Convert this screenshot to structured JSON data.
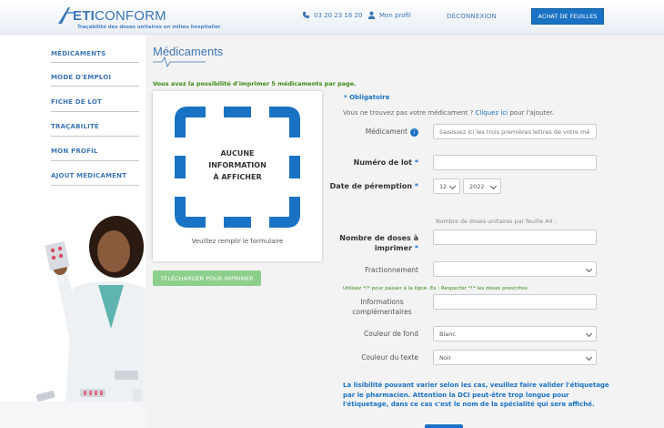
{
  "header": {
    "logo_part1": "ETI",
    "logo_part2": "CONFORM",
    "tagline": "Traçabilité des doses unitaires en milieu hospitalier",
    "phone": "03 20 23 16 20",
    "profile_label": "Mon profil",
    "logout_label": "DÉCONNEXION",
    "buy_label": "ACHAT DE FEUILLES"
  },
  "sidebar": {
    "items": [
      {
        "label": "MÉDICAMENTS"
      },
      {
        "label": "MODE D'EMPLOI"
      },
      {
        "label": "FICHE DE LOT"
      },
      {
        "label": "TRAÇABILITÉ"
      },
      {
        "label": "MON PROFIL"
      },
      {
        "label": "AJOUT MÉDICAMENT"
      }
    ]
  },
  "main": {
    "title": "Médicaments",
    "notice": "Vous avez la possibilité d'imprimer 5 médicaments par page.",
    "preview": {
      "line1": "AUCUNE",
      "line2": "INFORMATION",
      "line3": "À AFFICHER",
      "caption": "Veuillez remplir le formulaire"
    },
    "download_label": "TÉLÉCHARGER POUR IMPRIMER"
  },
  "form": {
    "required_note": "* Obligatoire",
    "not_found_prefix": "Vous ne trouvez pas votre médicament ?",
    "not_found_link": "Cliquez ici",
    "not_found_suffix": "pour l'ajouter.",
    "medicament_label": "Médicament",
    "medicament_placeholder": "Saisissez ici les trois premières lettres de votre mé",
    "lot_label": "Numéro de lot",
    "expiry_label": "Date de péremption",
    "expiry_month": "12",
    "expiry_year": "2022",
    "doses_hint": "Nombre de doses unitaires par feuille A4 :",
    "doses_label_1": "Nombre de doses à",
    "doses_label_2": "imprimer",
    "fraction_label": "Fractionnement",
    "fraction_hint": "Utilisez *!* pour passer à la ligne. Ex : Respecter *!* les doses prescrites.",
    "info_label_1": "Informations",
    "info_label_2": "complémentaires",
    "bg_color_label": "Couleur de fond",
    "bg_color_value": "Blanc",
    "text_color_label": "Couleur du texte",
    "text_color_value": "Noir",
    "warning": "La lisibilité pouvant varier selon les cas, veuillez faire valider l'étiquetage par le pharmacien. Attention la DCI peut-être trop longue pour l'étiquetage, dans ce cas c'est le nom de la spécialité qui sera affiché.",
    "star": "*"
  },
  "colors": {
    "accent": "#1a72c4",
    "brand_blue": "#3c76b6",
    "notice_green": "#3a8a16",
    "download_green": "#8ccf8a"
  }
}
